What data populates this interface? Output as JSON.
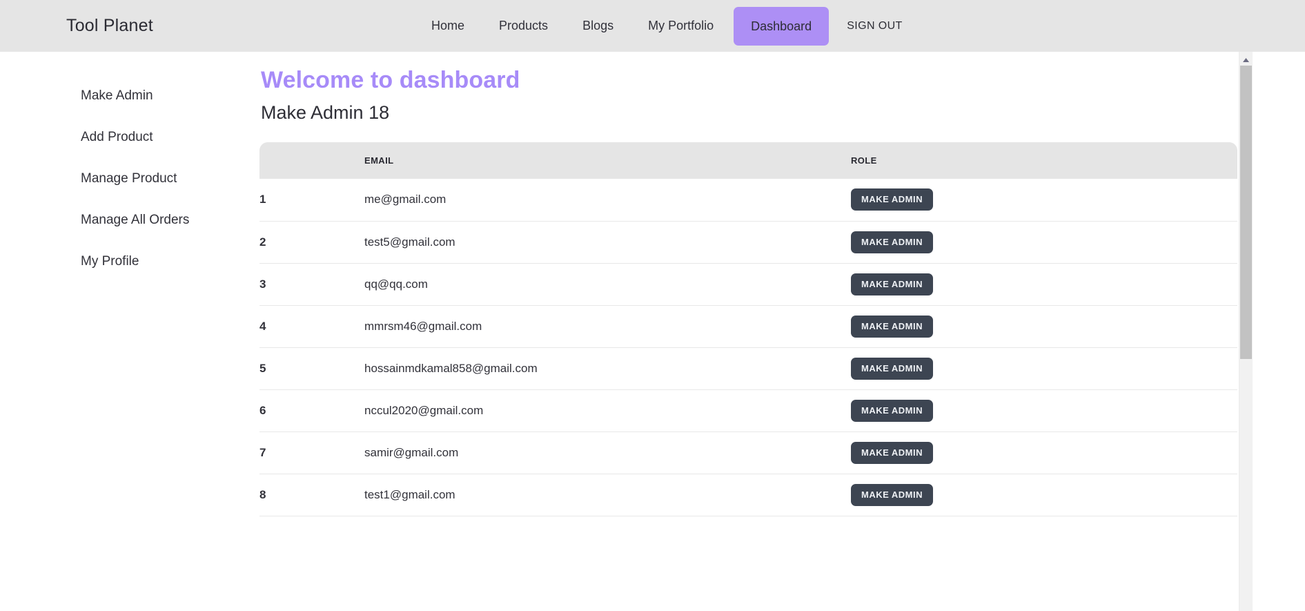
{
  "navbar": {
    "brand": "Tool Planet",
    "links": [
      {
        "label": "Home",
        "active": false
      },
      {
        "label": "Products",
        "active": false
      },
      {
        "label": "Blogs",
        "active": false
      },
      {
        "label": "My Portfolio",
        "active": false
      },
      {
        "label": "Dashboard",
        "active": true
      }
    ],
    "signout_label": "SIGN OUT",
    "background_color": "#e5e5e5",
    "active_pill_color": "#ad8ff5"
  },
  "sidebar": {
    "items": [
      {
        "label": "Make Admin"
      },
      {
        "label": "Add Product"
      },
      {
        "label": "Manage Product"
      },
      {
        "label": "Manage All Orders"
      },
      {
        "label": "My Profile"
      }
    ]
  },
  "main": {
    "welcome_title": "Welcome to dashboard",
    "welcome_title_color": "#a78bf8",
    "section_title": "Make Admin 18",
    "table": {
      "columns": {
        "index": "",
        "email": "EMAIL",
        "role": "ROLE"
      },
      "button_label": "MAKE ADMIN",
      "button_color": "#3d4552",
      "rows": [
        {
          "index": "1",
          "email": "me@gmail.com",
          "role_action": "MAKE ADMIN"
        },
        {
          "index": "2",
          "email": "test5@gmail.com",
          "role_action": "MAKE ADMIN"
        },
        {
          "index": "3",
          "email": "qq@qq.com",
          "role_action": "MAKE ADMIN"
        },
        {
          "index": "4",
          "email": "mmrsm46@gmail.com",
          "role_action": "MAKE ADMIN"
        },
        {
          "index": "5",
          "email": "hossainmdkamal858@gmail.com",
          "role_action": "MAKE ADMIN"
        },
        {
          "index": "6",
          "email": "nccul2020@gmail.com",
          "role_action": "MAKE ADMIN"
        },
        {
          "index": "7",
          "email": "samir@gmail.com",
          "role_action": "MAKE ADMIN"
        },
        {
          "index": "8",
          "email": "test1@gmail.com",
          "role_action": "MAKE ADMIN"
        }
      ]
    }
  },
  "scrollbar": {
    "up_arrow": "▲"
  }
}
